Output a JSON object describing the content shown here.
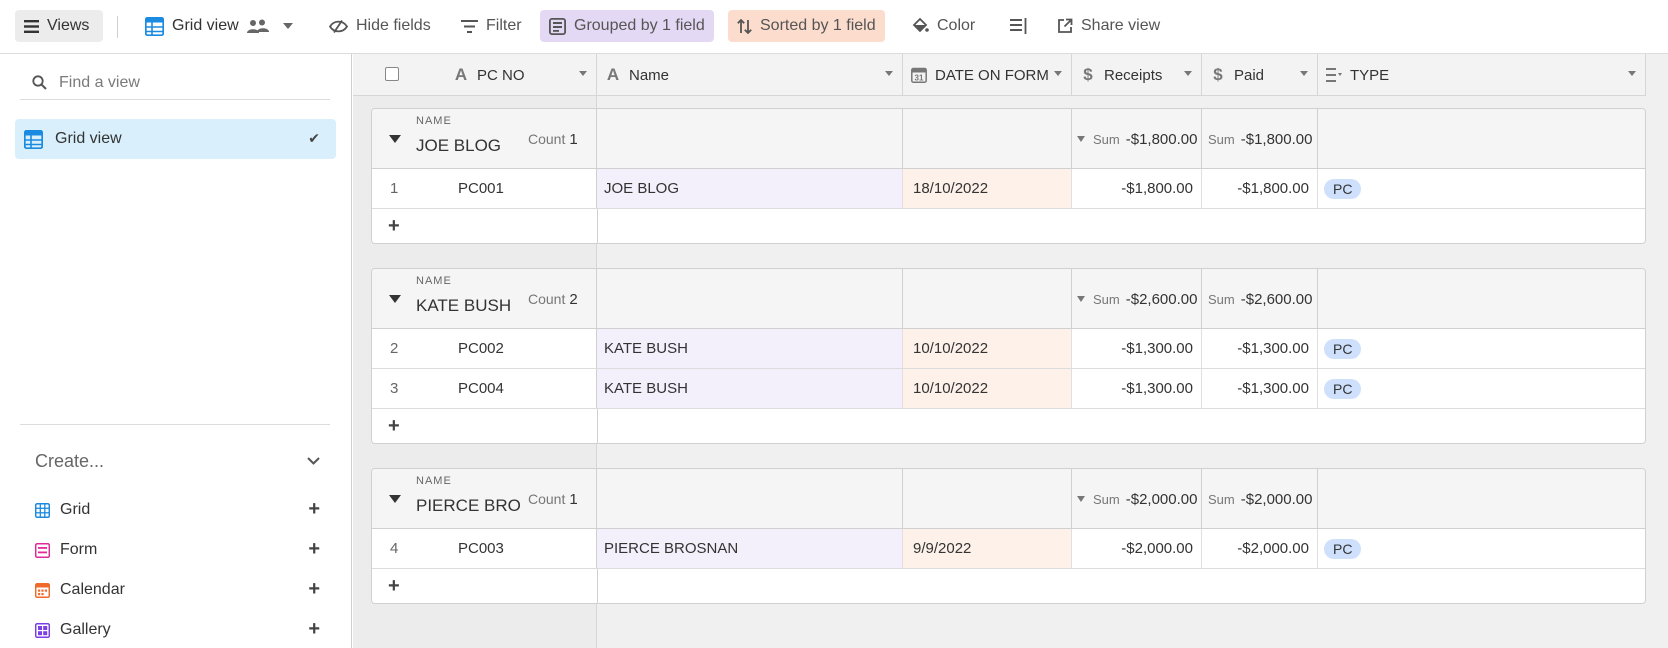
{
  "toolbar": {
    "views_label": "Views",
    "grid_view_label": "Grid view",
    "hide_fields_label": "Hide fields",
    "filter_label": "Filter",
    "grouped_label": "Grouped by 1 field",
    "sorted_label": "Sorted by 1 field",
    "color_label": "Color",
    "share_label": "Share view",
    "colors": {
      "grouped_bg": "#e4d9f4",
      "sorted_bg": "#fbdccd"
    }
  },
  "sidebar": {
    "search_placeholder": "Find a view",
    "views": [
      {
        "label": "Grid view",
        "selected": true
      }
    ],
    "create_label": "Create...",
    "create_items": [
      {
        "label": "Grid",
        "icon": "grid-icon",
        "color": "#1a8be0"
      },
      {
        "label": "Form",
        "icon": "form-icon",
        "color": "#e02a9a"
      },
      {
        "label": "Calendar",
        "icon": "calendar-icon",
        "color": "#f06a2a"
      },
      {
        "label": "Gallery",
        "icon": "gallery-icon",
        "color": "#7b3fe4"
      }
    ]
  },
  "grid": {
    "columns": [
      {
        "label": "PC NO",
        "icon": "text-field-icon"
      },
      {
        "label": "Name",
        "icon": "text-field-icon"
      },
      {
        "label": "DATE ON FORM",
        "icon": "date-field-icon"
      },
      {
        "label": "Receipts",
        "icon": "currency-field-icon"
      },
      {
        "label": "Paid",
        "icon": "currency-field-icon"
      },
      {
        "label": "TYPE",
        "icon": "select-field-icon"
      }
    ],
    "group_caption": "NAME",
    "count_label": "Count",
    "sum_label": "Sum",
    "groups": [
      {
        "name": "JOE BLOG",
        "count": "1",
        "sum_receipts": "-$1,800.00",
        "sum_paid": "-$1,800.00",
        "rows": [
          {
            "index": "1",
            "pc_no": "PC001",
            "name": "JOE BLOG",
            "date": "18/10/2022",
            "receipts": "-$1,800.00",
            "paid": "-$1,800.00",
            "type": "PC"
          }
        ]
      },
      {
        "name": "KATE BUSH",
        "count": "2",
        "sum_receipts": "-$2,600.00",
        "sum_paid": "-$2,600.00",
        "rows": [
          {
            "index": "2",
            "pc_no": "PC002",
            "name": "KATE BUSH",
            "date": "10/10/2022",
            "receipts": "-$1,300.00",
            "paid": "-$1,300.00",
            "type": "PC"
          },
          {
            "index": "3",
            "pc_no": "PC004",
            "name": "KATE BUSH",
            "date": "10/10/2022",
            "receipts": "-$1,300.00",
            "paid": "-$1,300.00",
            "type": "PC"
          }
        ]
      },
      {
        "name": "PIERCE BROSNAN",
        "count": "1",
        "sum_receipts": "-$2,000.00",
        "sum_paid": "-$2,000.00",
        "rows": [
          {
            "index": "4",
            "pc_no": "PC003",
            "name": "PIERCE BROSNAN",
            "date": "9/9/2022",
            "receipts": "-$2,000.00",
            "paid": "-$2,000.00",
            "type": "PC"
          }
        ]
      }
    ],
    "colors": {
      "name_cell_bg": "#f3f0fb",
      "date_cell_bg": "#fdf1ea",
      "type_badge_bg": "#cfe0fc"
    }
  }
}
